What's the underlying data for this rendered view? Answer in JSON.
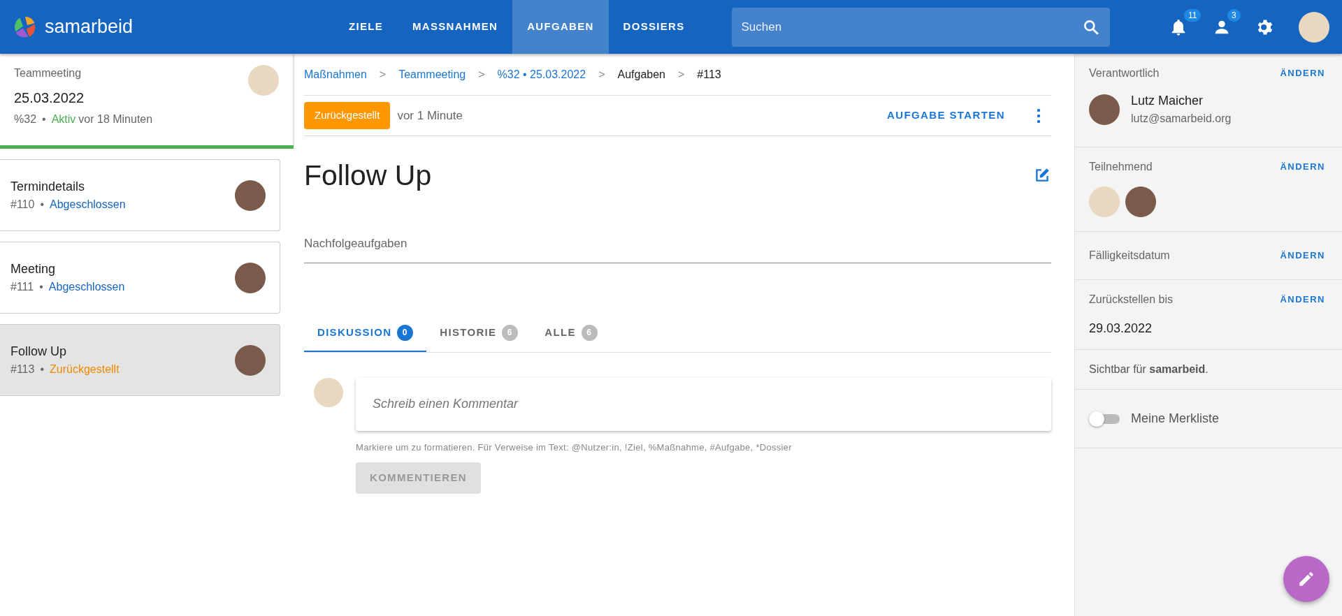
{
  "app": {
    "name": "samarbeid"
  },
  "nav": [
    {
      "label": "ZIELE",
      "selected": false
    },
    {
      "label": "MASSNAHMEN",
      "selected": false
    },
    {
      "label": "AUFGABEN",
      "selected": true
    },
    {
      "label": "DOSSIERS",
      "selected": false
    }
  ],
  "search": {
    "placeholder": "Suchen"
  },
  "header_badges": {
    "notifications": "11",
    "users": "3"
  },
  "process": {
    "title": "Teammeeting",
    "date": "25.03.2022",
    "id": "%32",
    "status": "Aktiv",
    "color": "#4caf50",
    "time": "vor 18 Minuten"
  },
  "meta_separator": "•",
  "tasks": [
    {
      "title": "Termindetails",
      "id": "#110",
      "status": "Abgeschlossen",
      "color": "#1565c0",
      "selected": false
    },
    {
      "title": "Meeting",
      "id": "#111",
      "status": "Abgeschlossen",
      "color": "#1565c0",
      "selected": false
    },
    {
      "title": "Follow Up",
      "id": "#113",
      "status": "Zurückgestellt",
      "color": "#ef8a00",
      "selected": true
    }
  ],
  "breadcrumb": [
    {
      "label": "Maßnahmen",
      "kind": "link"
    },
    {
      "label": "Teammeeting",
      "kind": "link"
    },
    {
      "label": "%32 • 25.03.2022",
      "kind": "link"
    },
    {
      "label": "Aufgaben",
      "kind": "text"
    },
    {
      "label": "#113",
      "kind": "text"
    }
  ],
  "breadcrumb_separator": ">",
  "status_bar": {
    "status": "Zurückgestellt",
    "time": "vor 1 Minute",
    "action": "AUFGABE STARTEN"
  },
  "task_title": "Follow Up",
  "followup_field": {
    "placeholder": "Nachfolgeaufgaben"
  },
  "tabs": [
    {
      "label": "DISKUSSION",
      "count": "0",
      "selected": true
    },
    {
      "label": "HISTORIE",
      "count": "6",
      "selected": false
    },
    {
      "label": "ALLE",
      "count": "6",
      "selected": false
    }
  ],
  "comment": {
    "placeholder": "Schreib einen Kommentar",
    "hint": "Markiere um zu formatieren. Für Verweise im Text: @Nutzer:in, !Ziel, %Maßnahme, #Aufgabe, *Dossier",
    "button": "KOMMENTIEREN",
    "disabled": true
  },
  "sidebar": {
    "responsible": {
      "label": "Verantwortlich",
      "action": "ÄNDERN",
      "name": "Lutz Maicher",
      "email": "lutz@samarbeid.org"
    },
    "participants": {
      "label": "Teilnehmend",
      "action": "ÄNDERN",
      "people": [
        {
          "kind": "avatar"
        },
        {
          "kind": "avatar"
        }
      ]
    },
    "due": {
      "label": "Fälligkeitsdatum",
      "action": "ÄNDERN"
    },
    "snooze": {
      "label": "Zurückstellen bis",
      "action": "ÄNDERN",
      "value": "29.03.2022"
    },
    "visibility": "Sichtbar für **samarbeid**.",
    "watchlist": {
      "label": "Meine Merkliste",
      "on": false
    }
  }
}
